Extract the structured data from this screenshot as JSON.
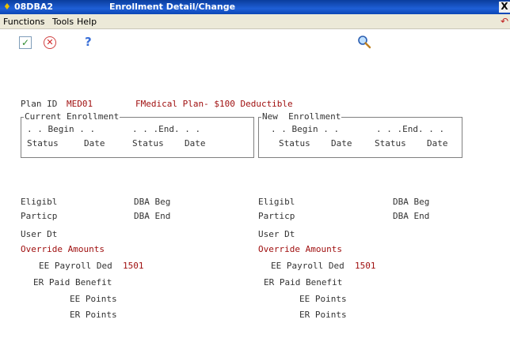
{
  "window": {
    "id": "08DBA2",
    "title": "Enrollment Detail/Change",
    "close_glyph": "X"
  },
  "menu": {
    "items": [
      {
        "label": "Functions"
      },
      {
        "label": "Tools"
      },
      {
        "label": "Help"
      }
    ]
  },
  "toolbar": {
    "ok_icon": "checkmark-icon",
    "cancel_icon": "cancel-icon",
    "help_icon": "question-icon",
    "search_icon": "magnifier-icon",
    "help_glyph": "?"
  },
  "plan": {
    "label": "Plan ID",
    "id": "MED01",
    "description": "FMedical Plan- $100 Deductible"
  },
  "current_enrollment": {
    "title": "Current Enrollment",
    "begin_label": ". . Begin . .",
    "end_label": ". . .End. . .",
    "cols": [
      "Status",
      "Date",
      "Status",
      "Date"
    ]
  },
  "new_enrollment": {
    "title": "New  Enrollment",
    "begin_label": ". . Begin . .",
    "end_label": ". . .End. . .",
    "cols": [
      "Status",
      "Date",
      "Status",
      "Date"
    ]
  },
  "left": {
    "eligibl": "Eligibl",
    "dba_beg": "DBA Beg",
    "particp": "Particp",
    "dba_end": "DBA End",
    "user_dt": "User Dt",
    "override": "Override Amounts",
    "ee_payroll": "EE Payroll Ded",
    "ee_payroll_value": "1501",
    "er_paid": "ER Paid Benefit",
    "ee_points": "EE Points",
    "er_points": "ER Points"
  },
  "right": {
    "eligibl": "Eligibl",
    "dba_beg": "DBA Beg",
    "particp": "Particp",
    "dba_end": "DBA End",
    "user_dt": "User Dt",
    "override": "Override Amounts",
    "ee_payroll": "EE Payroll Ded",
    "ee_payroll_value": "1501",
    "er_paid": "ER Paid Benefit",
    "ee_points": "EE Points",
    "er_points": "ER Points"
  },
  "colors": {
    "title_bar": "#1f5fd6",
    "field_value": "#a01010",
    "menu_bg": "#ece9d8"
  }
}
